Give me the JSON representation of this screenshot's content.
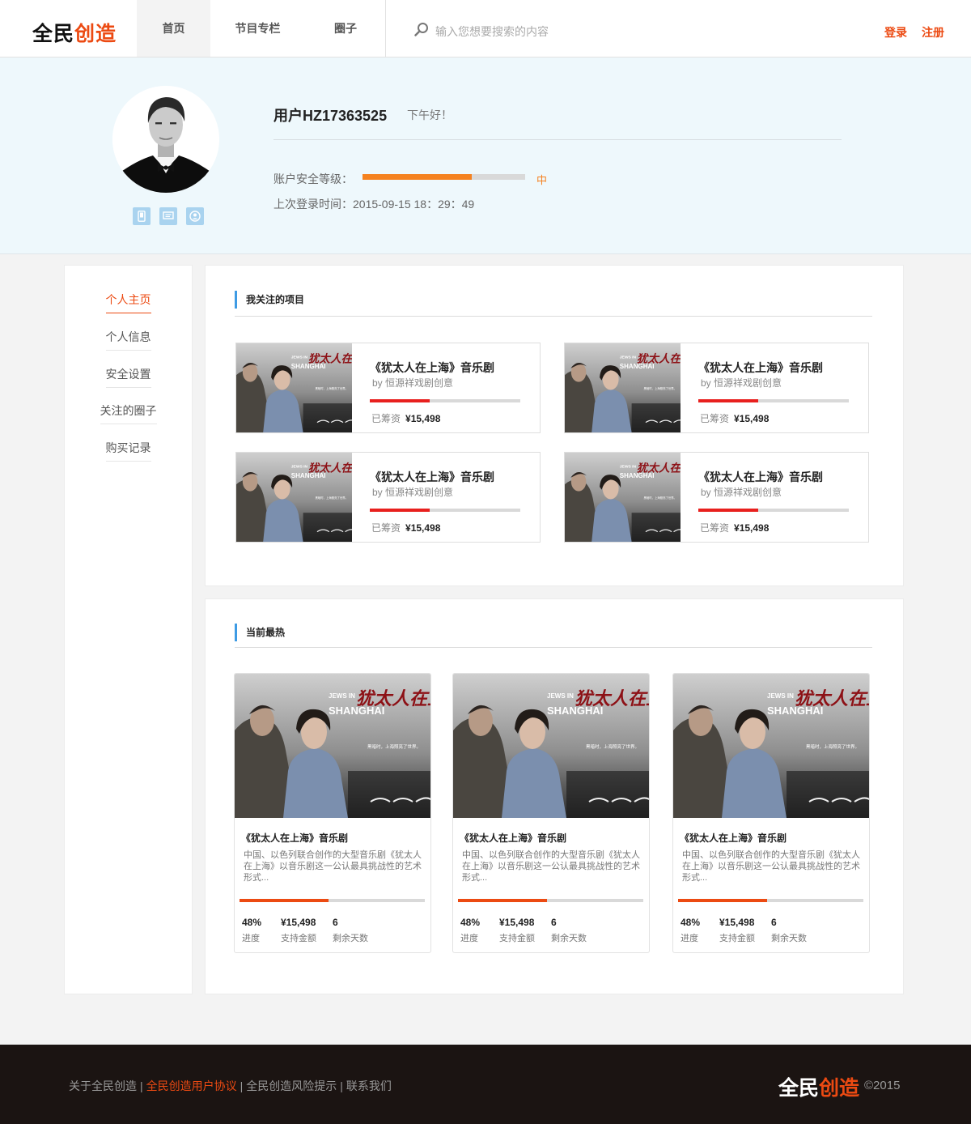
{
  "brand": {
    "part1": "全民",
    "part2": "创造",
    "accent": "#ec4a12"
  },
  "nav": {
    "items": [
      {
        "label": "首页",
        "active": true
      },
      {
        "label": "节目专栏",
        "active": false
      },
      {
        "label": "圈子",
        "active": false
      }
    ]
  },
  "search": {
    "placeholder": "输入您想要搜索的内容",
    "icon": "search-icon"
  },
  "auth": {
    "login": "登录",
    "register": "注册"
  },
  "profile": {
    "username": "用户HZ17363525",
    "greeting": "下午好！",
    "security_label": "账户安全等级：",
    "security_level": "中",
    "security_progress": 0.67,
    "last_login": "上次登录时间：2015-09-15 18：29：49",
    "quick_icons": [
      "phone-icon",
      "message-icon",
      "user-icon"
    ]
  },
  "sidebar": {
    "items": [
      {
        "label": "个人主页",
        "active": true
      },
      {
        "label": "个人信息",
        "active": false
      },
      {
        "label": "安全设置",
        "active": false
      },
      {
        "label": "关注的圈子",
        "active": false
      },
      {
        "label": "购买记录",
        "active": false
      }
    ]
  },
  "followed": {
    "title": "我关注的项目",
    "items": [
      {
        "title": "《犹太人在上海》音乐剧",
        "by": "by 恒源祥戏剧创意",
        "raised_label": "已筹资",
        "raised": "¥15,498",
        "progress": 0.4
      },
      {
        "title": "《犹太人在上海》音乐剧",
        "by": "by 恒源祥戏剧创意",
        "raised_label": "已筹资",
        "raised": "¥15,498",
        "progress": 0.4
      },
      {
        "title": "《犹太人在上海》音乐剧",
        "by": "by 恒源祥戏剧创意",
        "raised_label": "已筹资",
        "raised": "¥15,498",
        "progress": 0.4
      },
      {
        "title": "《犹太人在上海》音乐剧",
        "by": "by 恒源祥戏剧创意",
        "raised_label": "已筹资",
        "raised": "¥15,498",
        "progress": 0.4
      }
    ]
  },
  "hot": {
    "title": "当前最热",
    "items": [
      {
        "title": "《犹太人在上海》音乐剧",
        "desc": "中国、以色列联合创作的大型音乐剧《犹太人在上海》以音乐剧这一公认最具挑战性的艺术形式...",
        "progress": 0.48,
        "progress_text": "48%",
        "progress_label": "进度",
        "amount": "¥15,498",
        "amount_label": "支持金额",
        "days": "6",
        "days_label": "剩余天数"
      },
      {
        "title": "《犹太人在上海》音乐剧",
        "desc": "中国、以色列联合创作的大型音乐剧《犹太人在上海》以音乐剧这一公认最具挑战性的艺术形式...",
        "progress": 0.48,
        "progress_text": "48%",
        "progress_label": "进度",
        "amount": "¥15,498",
        "amount_label": "支持金额",
        "days": "6",
        "days_label": "剩余天数"
      },
      {
        "title": "《犹太人在上海》音乐剧",
        "desc": "中国、以色列联合创作的大型音乐剧《犹太人在上海》以音乐剧这一公认最具挑战性的艺术形式...",
        "progress": 0.48,
        "progress_text": "48%",
        "progress_label": "进度",
        "amount": "¥15,498",
        "amount_label": "支持金额",
        "days": "6",
        "days_label": "剩余天数"
      }
    ]
  },
  "poster": {
    "latin": "JEWS IN SHANGHAI",
    "title_cn": "犹太人在上海",
    "tagline": "黑暗时，上海照亮了世界。"
  },
  "footer": {
    "links": [
      {
        "label": "关于全民创造",
        "highlight": false
      },
      {
        "label": "全民创造用户协议",
        "highlight": true
      },
      {
        "label": "全民创造风险提示",
        "highlight": false
      },
      {
        "label": "联系我们",
        "highlight": false
      }
    ],
    "separator": "|",
    "logo_part1": "全民",
    "logo_part2": "创造",
    "copyright": "©2015"
  }
}
